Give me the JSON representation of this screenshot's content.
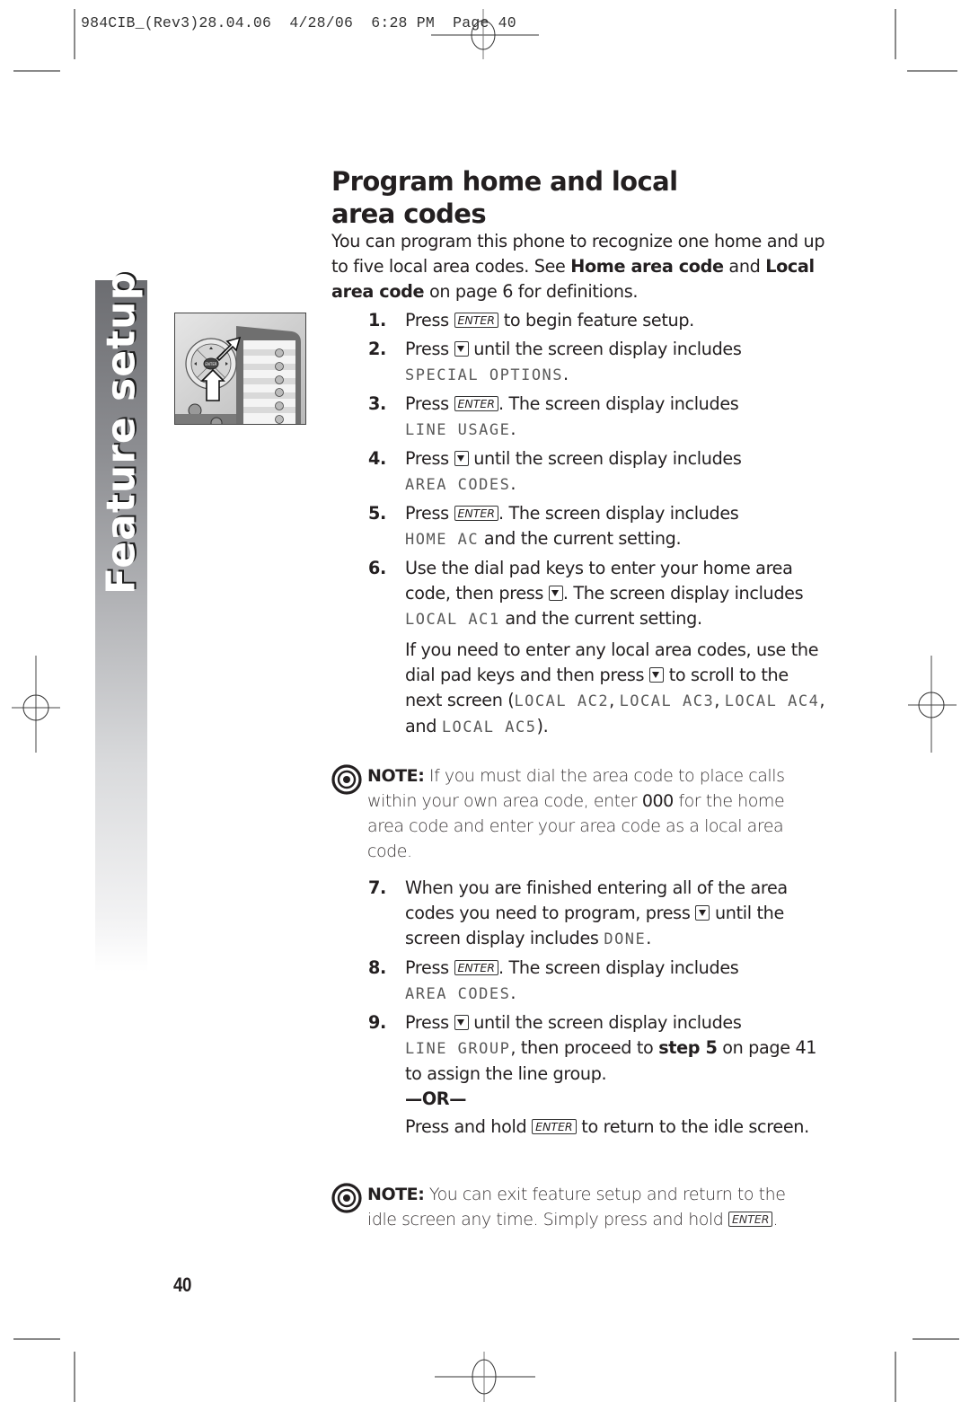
{
  "print_slug": "984CIB_(Rev3)28.04.06  4/28/06  6:28 PM  Page 40",
  "sidebar": {
    "section_title": "Feature setup"
  },
  "figure": {
    "description": "handset-navigation-keys-illustration",
    "center_key_label": "ENTER"
  },
  "heading": {
    "line1": "Program home and local",
    "line2": "area codes"
  },
  "intro": {
    "part1": "You can program this phone to recognize one home and up to five local area codes.  See ",
    "bold1": "Home area code",
    "part2": " and ",
    "bold2": "Local area code",
    "part3": " on page 6 for definitions."
  },
  "keys": {
    "enter": "ENTER",
    "down": "down-arrow-key"
  },
  "steps": [
    {
      "num": "1.",
      "a": "Press ",
      "b": " to begin feature setup."
    },
    {
      "num": "2.",
      "a": "Press ",
      "b": " until the screen display includes",
      "lcd": "SPECIAL OPTIONS",
      "c": "."
    },
    {
      "num": "3.",
      "a": "Press ",
      "b": ". The screen display includes",
      "lcd": "LINE USAGE",
      "c": "."
    },
    {
      "num": "4.",
      "a": "Press ",
      "b": " until the screen display includes",
      "lcd": "AREA CODES",
      "c": "."
    },
    {
      "num": "5.",
      "a": "Press ",
      "b": ". The screen display includes",
      "lcd": "HOME AC",
      "c": " and the current setting."
    },
    {
      "num": "6.",
      "a": "Use the dial pad keys to enter your home area code, then press ",
      "b": ". The screen display includes",
      "lcd": "LOCAL AC1",
      "c": " and the current setting.",
      "extra": {
        "a": "If you need to enter any local area codes, use the dial pad keys and then press ",
        "b": " to scroll to the next screen (",
        "lcd1": "LOCAL AC2",
        "sep1": ", ",
        "lcd2": "LOCAL AC3",
        "sep2": ", ",
        "lcd3": "LOCAL AC4",
        "sep3": ",  and ",
        "lcd4": "LOCAL AC5",
        "end": ")."
      }
    },
    {
      "num": "7.",
      "a": "When you are finished entering all of the area codes you need to program,  press ",
      "b": " until the screen display includes ",
      "lcd": "DONE",
      "c": "."
    },
    {
      "num": "8.",
      "a": "Press ",
      "b": ". The screen display includes",
      "lcd": "AREA CODES",
      "c": "."
    },
    {
      "num": "9.",
      "a": "Press ",
      "b": " until the screen display includes",
      "lcd": "LINE GROUP",
      "c": ", then proceed to ",
      "bold": "step 5",
      "d": " on page 41 to assign the line group.",
      "or": "—OR—",
      "alt_a": "Press and hold ",
      "alt_b": " to return to the idle screen."
    }
  ],
  "notes": [
    {
      "label": "NOTE:",
      "a": "  If you must dial the area code to place calls within your own area code, enter ",
      "bold": "000",
      "b": " for the home area code and enter your area code as a local area code."
    },
    {
      "label": "NOTE:",
      "a": "  You can exit feature setup and return to the idle screen any time.  Simply press and hold ",
      "b": "."
    }
  ],
  "page_number": "40"
}
